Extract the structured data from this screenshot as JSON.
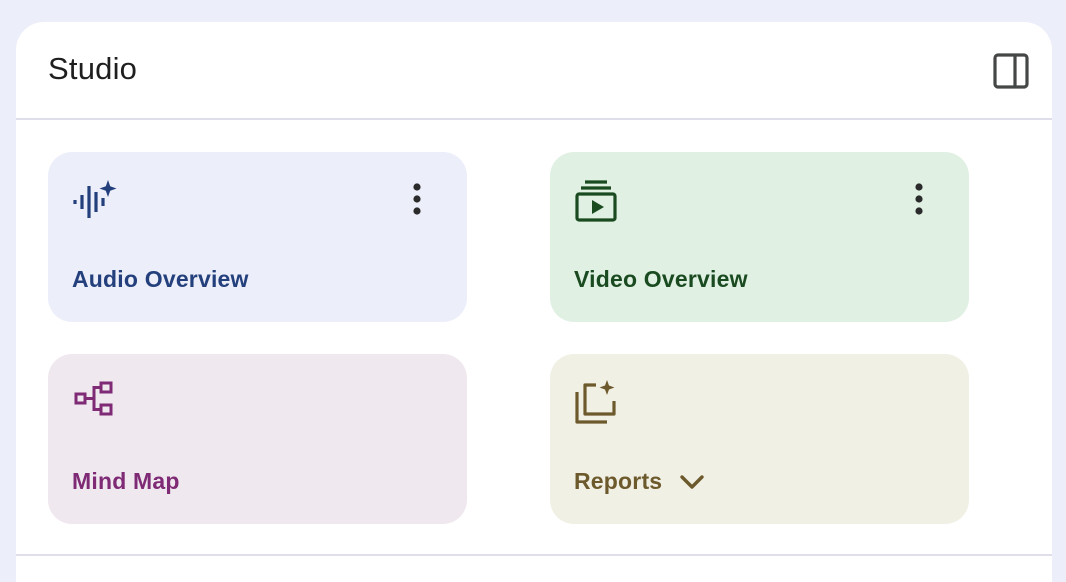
{
  "studio": {
    "title": "Studio",
    "toggle_icon": "side-panel-icon"
  },
  "cards": [
    {
      "label": "Audio Overview",
      "icon": "audio-waveform-sparkle-icon",
      "has_menu": true,
      "color": "#24407C",
      "background": "#ECEEFA"
    },
    {
      "label": "Video Overview",
      "icon": "video-stack-play-icon",
      "has_menu": true,
      "color": "#1A4B20",
      "background": "#E0F0E3"
    },
    {
      "label": "Mind Map",
      "icon": "mind-map-icon",
      "has_menu": false,
      "color": "#7E2A75",
      "background": "#F0E8EF"
    },
    {
      "label": "Reports",
      "icon": "report-sparkle-icon",
      "has_menu": false,
      "has_dropdown": true,
      "color": "#6D5A2C",
      "background": "#F1F0E5"
    }
  ],
  "colors": {
    "page_background": "#ECEEF9",
    "panel_background": "#FFFFFF",
    "divider": "#DEDFEA"
  }
}
